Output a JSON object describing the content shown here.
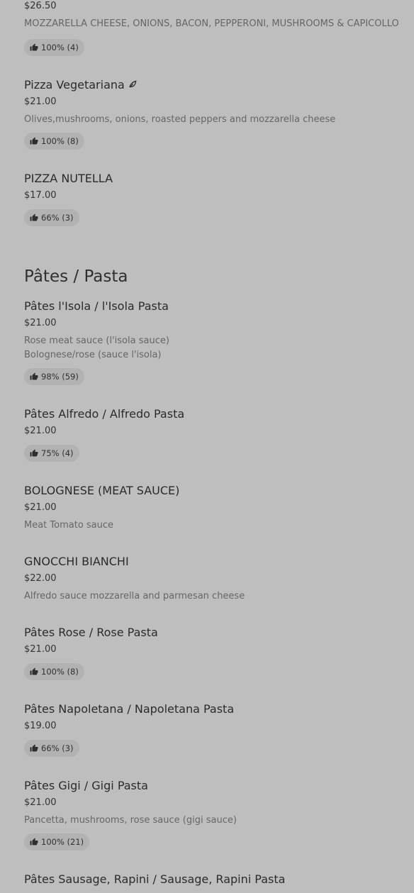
{
  "items_before": [
    {
      "price": "$26.50",
      "description": "MOZZARELLA CHEESE, ONIONS, BACON, PEPPERONI, MUSHROOMS & CAPICOLLO",
      "rating": "100% (4)"
    },
    {
      "name": "Pizza Vegetariana",
      "icon": "leaf-icon",
      "price": "$21.00",
      "description": "Olives,mushrooms, onions, roasted peppers and mozzarella cheese",
      "rating": "100% (8)"
    },
    {
      "name": "PIZZA NUTELLA",
      "price": "$17.00",
      "rating": "66% (3)"
    }
  ],
  "section": {
    "title": "Pâtes / Pasta"
  },
  "pasta_items": [
    {
      "name": "Pâtes l'Isola / l'Isola Pasta",
      "price": "$21.00",
      "description": "Rose meat sauce (l'isola sauce)\nBolognese/rose (sauce l'isola)",
      "rating": "98% (59)"
    },
    {
      "name": "Pâtes Alfredo / Alfredo Pasta",
      "price": "$21.00",
      "rating": "75% (4)"
    },
    {
      "name": "BOLOGNESE (MEAT SAUCE)",
      "price": "$21.00",
      "description": "Meat Tomato sauce"
    },
    {
      "name": "GNOCCHI BIANCHI",
      "price": "$22.00",
      "description": "Alfredo sauce mozzarella and parmesan cheese"
    },
    {
      "name": "Pâtes Rose / Rose Pasta",
      "price": "$21.00",
      "rating": "100% (8)"
    },
    {
      "name": "Pâtes Napoletana / Napoletana Pasta",
      "price": "$19.00",
      "rating": "66% (3)"
    },
    {
      "name": "Pâtes Gigi / Gigi Pasta",
      "price": "$21.00",
      "description": "Pancetta, mushrooms, rose sauce (gigi sauce)",
      "rating": "100% (21)"
    },
    {
      "name": "Pâtes Sausage, Rapini / Sausage, Rapini Pasta"
    }
  ],
  "icons": {
    "rating": "thumbs-up-icon",
    "vegetarian": "leaf-icon"
  },
  "colors": {
    "background": "#bebebe",
    "badge": "#b2b2b2"
  }
}
